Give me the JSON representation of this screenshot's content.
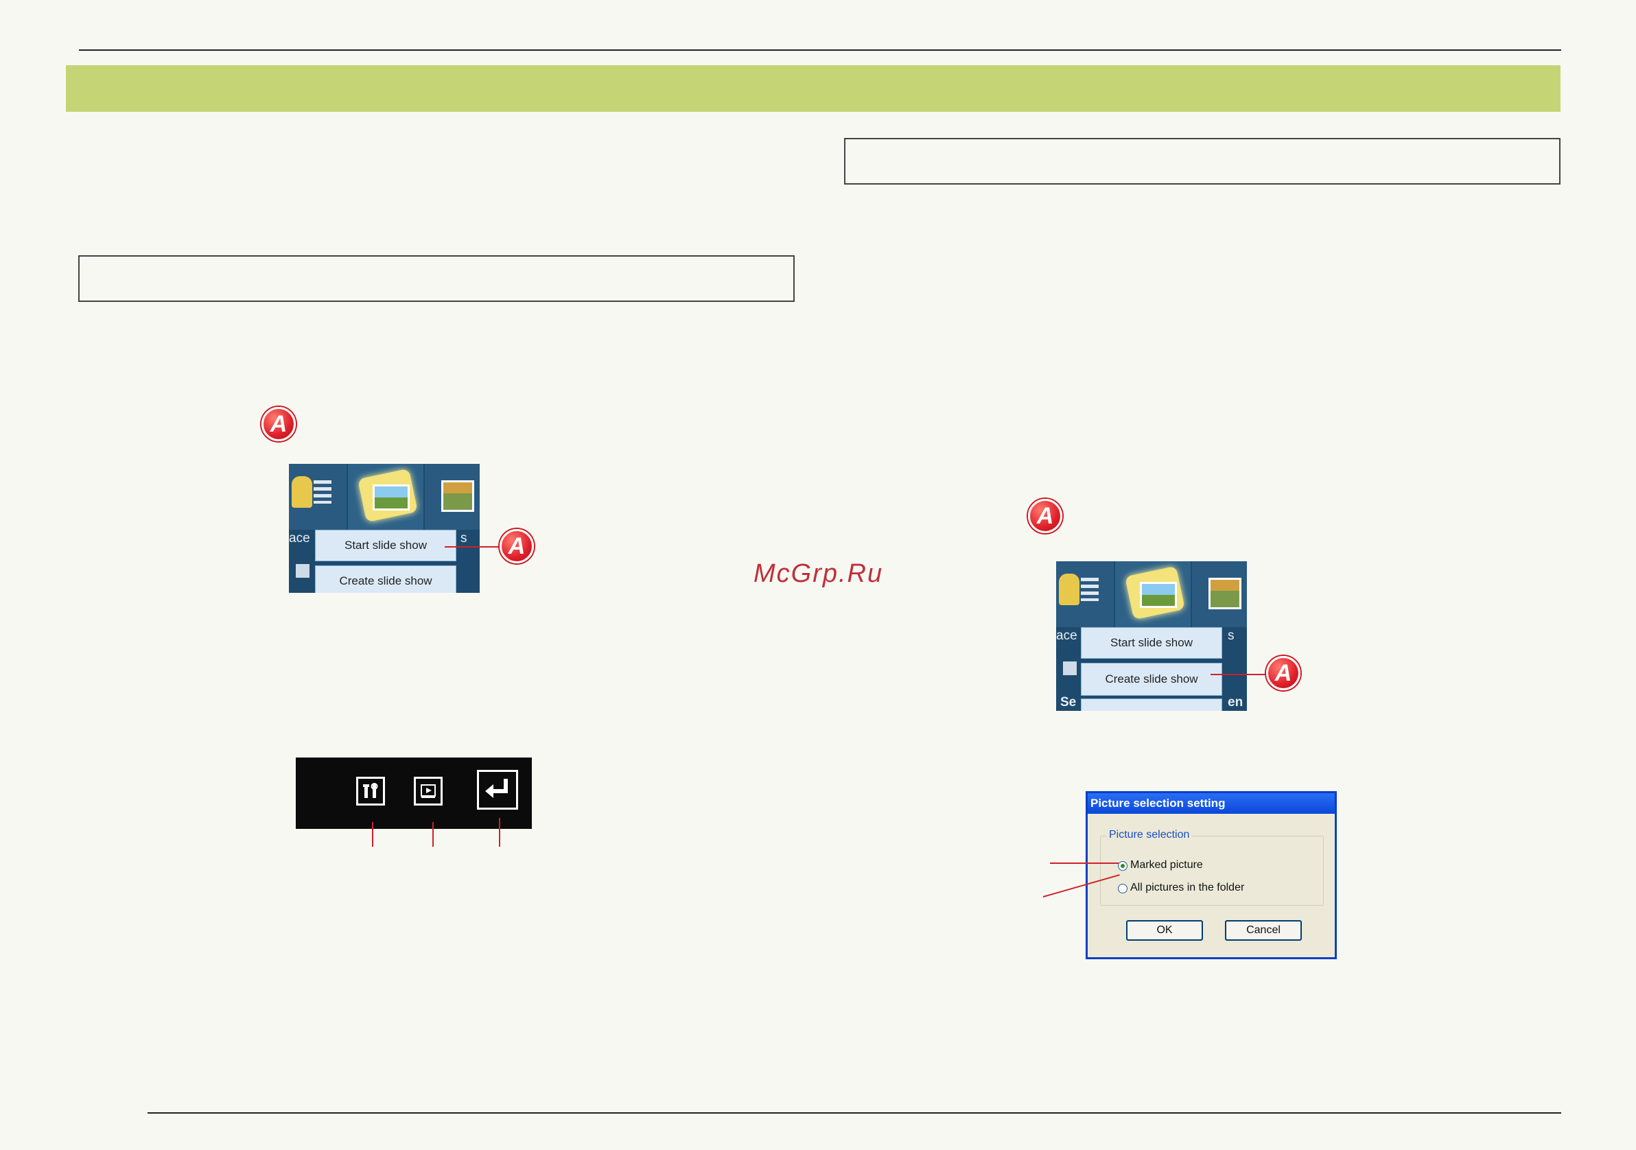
{
  "watermark": "McGrp.Ru",
  "badge_letter": "A",
  "menu_left": {
    "item1": "Start slide show",
    "item2": "Create slide show",
    "side1": "ace",
    "side2": "s"
  },
  "menu_right": {
    "item1": "Start slide show",
    "item2": "Create slide show",
    "side1": "ace",
    "side2": "s",
    "side3": "Se",
    "side4": "en"
  },
  "dialog": {
    "title": "Picture selection setting",
    "group_label": "Picture selection",
    "option1": "Marked picture",
    "option2": "All pictures in the folder",
    "ok": "OK",
    "cancel": "Cancel"
  },
  "colors": {
    "banner": "#c5d576",
    "accent_red": "#d0202a",
    "menu_bg": "#1e4a6e"
  },
  "icons": [
    "tools-icon",
    "play-icon",
    "return-icon"
  ]
}
